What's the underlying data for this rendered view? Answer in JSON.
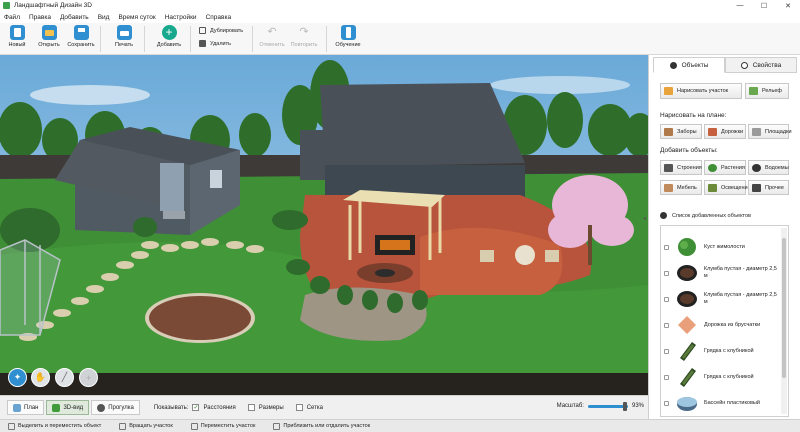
{
  "window": {
    "title": "Ландшафтный Дизайн 3D",
    "controls": [
      "—",
      "☐",
      "✕"
    ]
  },
  "menu": [
    "Файл",
    "Правка",
    "Добавить",
    "Вид",
    "Время суток",
    "Настройки",
    "Справка"
  ],
  "toolbar": {
    "new": "Новый",
    "open": "Открыть",
    "save": "Сохранить",
    "print": "Печать",
    "add": "Добавить",
    "duplicate": "Дублировать",
    "delete": "Удалить",
    "undo": "Отменить",
    "redo": "Повторить",
    "learn": "Обучение"
  },
  "view_modes": [
    {
      "label": "План",
      "active": false
    },
    {
      "label": "3D-вид",
      "active": true
    },
    {
      "label": "Прогулка",
      "active": false
    }
  ],
  "show": {
    "label": "Показывать:",
    "options": [
      {
        "label": "Расстояния",
        "checked": true
      },
      {
        "label": "Размеры",
        "checked": false
      },
      {
        "label": "Сетка",
        "checked": false
      }
    ]
  },
  "scale": {
    "label": "Масштаб:",
    "value_text": "93%",
    "value": 0.93
  },
  "hints": [
    "Выделить и переместить объект",
    "Вращать участок",
    "Переместить участок",
    "Приблизить или отдалить участок"
  ],
  "panel": {
    "tabs": [
      {
        "label": "Объекты",
        "active": true,
        "icon": "layers-icon"
      },
      {
        "label": "Свойства",
        "active": false,
        "icon": "settings-icon"
      }
    ],
    "draw_plot": "Нарисовать участок",
    "relief": "Рельеф",
    "draw_on_plan_label": "Нарисовать на плане:",
    "draw_buttons": [
      "Заборы",
      "Дорожки",
      "Площадки"
    ],
    "add_objects_label": "Добавить объекты:",
    "add_buttons": [
      "Строения",
      "Растения",
      "Водоемы",
      "Мебель",
      "Освещение",
      "Прочее"
    ],
    "list_header": "Список добавленных объектов",
    "list_items": [
      {
        "label": "Куст жимолости",
        "thumb": "bush"
      },
      {
        "label": "Клумба пустая - диаметр 2,5 м",
        "thumb": "flowerbed"
      },
      {
        "label": "Клумба пустая - диаметр 2,5 м",
        "thumb": "flowerbed"
      },
      {
        "label": "Дорожка из брусчатки",
        "thumb": "paving"
      },
      {
        "label": "Грядка с клубникой",
        "thumb": "strawberry-bed"
      },
      {
        "label": "Грядка с клубникой",
        "thumb": "strawberry-bed"
      },
      {
        "label": "Бассейн пластиковый",
        "thumb": "pool"
      }
    ]
  },
  "colors": {
    "accent": "#2f8fd0",
    "grass": "#3f8f36",
    "patio": "#b8543c",
    "roof": "#4a5058"
  }
}
